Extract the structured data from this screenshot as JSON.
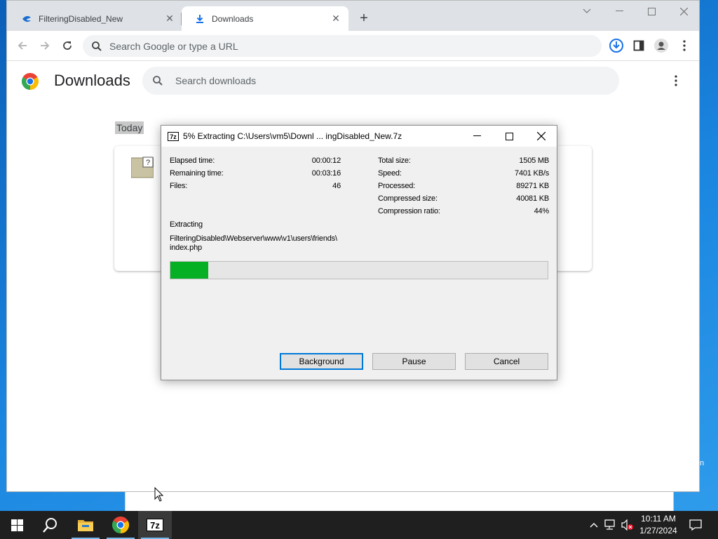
{
  "browser": {
    "tabs": [
      {
        "title": "FilteringDisabled_New",
        "active": false
      },
      {
        "title": "Downloads",
        "active": true
      }
    ],
    "omnibox_placeholder": "Search Google or type a URL"
  },
  "downloads_page": {
    "title": "Downloads",
    "search_placeholder": "Search downloads",
    "section_label": "Today"
  },
  "dialog": {
    "title": "5% Extracting C:\\Users\\vm5\\Downl ... ingDisabled_New.7z",
    "left_stats": [
      {
        "label": "Elapsed time:",
        "value": "00:00:12"
      },
      {
        "label": "Remaining time:",
        "value": "00:03:16"
      },
      {
        "label": "Files:",
        "value": "46"
      }
    ],
    "right_stats": [
      {
        "label": "Total size:",
        "value": "1505 MB"
      },
      {
        "label": "Speed:",
        "value": "7401 KB/s"
      },
      {
        "label": "Processed:",
        "value": "89271 KB"
      },
      {
        "label": "Compressed size:",
        "value": "40081 KB"
      },
      {
        "label": "Compression ratio:",
        "value": "44%"
      }
    ],
    "operation": "Extracting",
    "current_file_line1": "FilteringDisabled\\Webserver\\www\\v1\\users\\friends\\",
    "current_file_line2": "index.php",
    "progress_fraction": 0.1,
    "progress_color": "#06b025",
    "buttons": {
      "background": "Background",
      "pause": "Pause",
      "cancel": "Cancel"
    }
  },
  "taskbar": {
    "time": "10:11 AM",
    "date": "1/27/2024",
    "items": [
      "windows-start-icon",
      "search-icon",
      "file-explorer-icon",
      "chrome-icon",
      "7zip-icon"
    ]
  },
  "desktop": {
    "peek_text": "n"
  },
  "colors": {
    "accent_blue": "#1a73e8",
    "selection_blue": "#0078d7"
  }
}
